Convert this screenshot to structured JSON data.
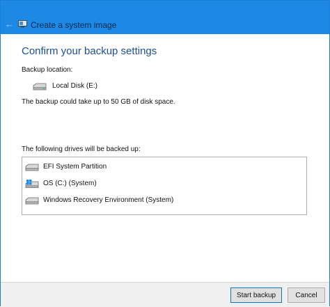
{
  "window": {
    "title": "Create a system image"
  },
  "page": {
    "heading": "Confirm your backup settings",
    "backup_location_label": "Backup location:",
    "backup_location_value": "Local Disk (E:)",
    "size_note": "The backup could take up to 50 GB of disk space.",
    "drives_label": "The following drives will be backed up:"
  },
  "drives": [
    {
      "label": "EFI System Partition",
      "icon": "drive-icon"
    },
    {
      "label": "OS (C:) (System)",
      "icon": "windows-drive-icon"
    },
    {
      "label": "Windows Recovery Environment (System)",
      "icon": "drive-icon"
    }
  ],
  "buttons": {
    "start_backup": "Start backup",
    "cancel": "Cancel"
  },
  "colors": {
    "titlebar": "#1e88e5",
    "heading": "#1c4f96"
  }
}
